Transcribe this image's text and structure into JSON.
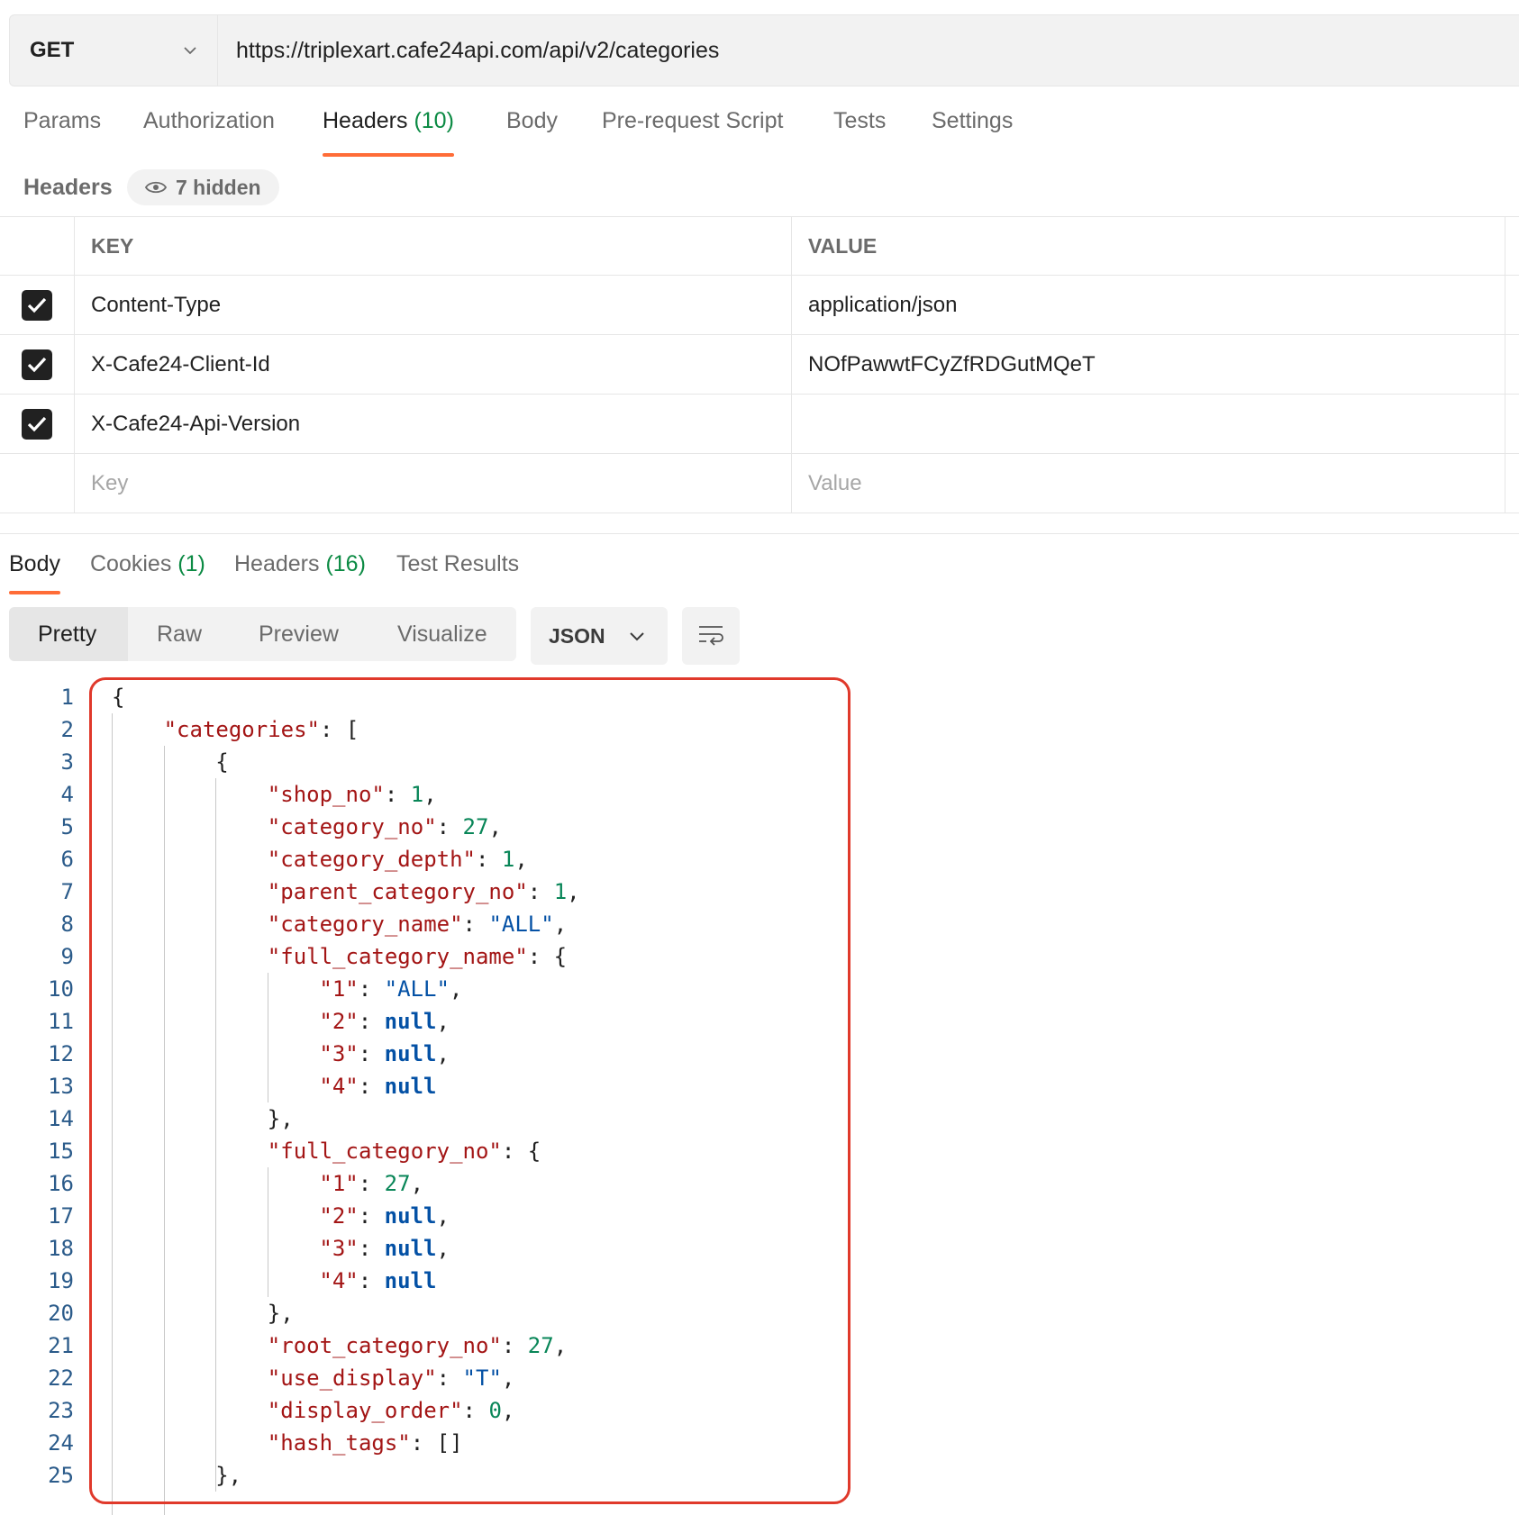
{
  "request": {
    "method": "GET",
    "url": "https://triplexart.cafe24api.com/api/v2/categories"
  },
  "request_tabs": [
    {
      "label": "Params",
      "count": ""
    },
    {
      "label": "Authorization",
      "count": ""
    },
    {
      "label": "Headers",
      "count": "(10)"
    },
    {
      "label": "Body",
      "count": ""
    },
    {
      "label": "Pre-request Script",
      "count": ""
    },
    {
      "label": "Tests",
      "count": ""
    },
    {
      "label": "Settings",
      "count": ""
    }
  ],
  "headers_section": {
    "title": "Headers",
    "hidden_label": "7 hidden",
    "col_key": "KEY",
    "col_value": "VALUE",
    "rows": [
      {
        "key": "Content-Type",
        "value": "application/json"
      },
      {
        "key": "X-Cafe24-Client-Id",
        "value": "NOfPawwtFCyZfRDGutMQeT"
      },
      {
        "key": "X-Cafe24-Api-Version",
        "value": ""
      }
    ],
    "key_placeholder": "Key",
    "value_placeholder": "Value"
  },
  "response_tabs": [
    {
      "label": "Body",
      "count": ""
    },
    {
      "label": "Cookies",
      "count": "(1)"
    },
    {
      "label": "Headers",
      "count": "(16)"
    },
    {
      "label": "Test Results",
      "count": ""
    }
  ],
  "view_modes": [
    "Pretty",
    "Raw",
    "Preview",
    "Visualize"
  ],
  "format": "JSON",
  "colors": {
    "accent": "#ff6c37",
    "count_green": "#0b8a43",
    "highlight_border": "#e0392b"
  },
  "code_lines": [
    {
      "n": "1",
      "indent": 0,
      "parts": [
        [
          "p",
          "{"
        ]
      ]
    },
    {
      "n": "2",
      "indent": 1,
      "parts": [
        [
          "k",
          "\"categories\""
        ],
        [
          "p",
          ": ["
        ]
      ]
    },
    {
      "n": "3",
      "indent": 2,
      "parts": [
        [
          "p",
          "{"
        ]
      ]
    },
    {
      "n": "4",
      "indent": 3,
      "parts": [
        [
          "k",
          "\"shop_no\""
        ],
        [
          "p",
          ": "
        ],
        [
          "n",
          "1"
        ],
        [
          "p",
          ","
        ]
      ]
    },
    {
      "n": "5",
      "indent": 3,
      "parts": [
        [
          "k",
          "\"category_no\""
        ],
        [
          "p",
          ": "
        ],
        [
          "n",
          "27"
        ],
        [
          "p",
          ","
        ]
      ]
    },
    {
      "n": "6",
      "indent": 3,
      "parts": [
        [
          "k",
          "\"category_depth\""
        ],
        [
          "p",
          ": "
        ],
        [
          "n",
          "1"
        ],
        [
          "p",
          ","
        ]
      ]
    },
    {
      "n": "7",
      "indent": 3,
      "parts": [
        [
          "k",
          "\"parent_category_no\""
        ],
        [
          "p",
          ": "
        ],
        [
          "n",
          "1"
        ],
        [
          "p",
          ","
        ]
      ]
    },
    {
      "n": "8",
      "indent": 3,
      "parts": [
        [
          "k",
          "\"category_name\""
        ],
        [
          "p",
          ": "
        ],
        [
          "s",
          "\"ALL\""
        ],
        [
          "p",
          ","
        ]
      ]
    },
    {
      "n": "9",
      "indent": 3,
      "parts": [
        [
          "k",
          "\"full_category_name\""
        ],
        [
          "p",
          ": {"
        ]
      ]
    },
    {
      "n": "10",
      "indent": 4,
      "parts": [
        [
          "k",
          "\"1\""
        ],
        [
          "p",
          ": "
        ],
        [
          "s",
          "\"ALL\""
        ],
        [
          "p",
          ","
        ]
      ]
    },
    {
      "n": "11",
      "indent": 4,
      "parts": [
        [
          "k",
          "\"2\""
        ],
        [
          "p",
          ": "
        ],
        [
          "nl",
          "null"
        ],
        [
          "p",
          ","
        ]
      ]
    },
    {
      "n": "12",
      "indent": 4,
      "parts": [
        [
          "k",
          "\"3\""
        ],
        [
          "p",
          ": "
        ],
        [
          "nl",
          "null"
        ],
        [
          "p",
          ","
        ]
      ]
    },
    {
      "n": "13",
      "indent": 4,
      "parts": [
        [
          "k",
          "\"4\""
        ],
        [
          "p",
          ": "
        ],
        [
          "nl",
          "null"
        ]
      ]
    },
    {
      "n": "14",
      "indent": 3,
      "parts": [
        [
          "p",
          "},"
        ]
      ]
    },
    {
      "n": "15",
      "indent": 3,
      "parts": [
        [
          "k",
          "\"full_category_no\""
        ],
        [
          "p",
          ": {"
        ]
      ]
    },
    {
      "n": "16",
      "indent": 4,
      "parts": [
        [
          "k",
          "\"1\""
        ],
        [
          "p",
          ": "
        ],
        [
          "n",
          "27"
        ],
        [
          "p",
          ","
        ]
      ]
    },
    {
      "n": "17",
      "indent": 4,
      "parts": [
        [
          "k",
          "\"2\""
        ],
        [
          "p",
          ": "
        ],
        [
          "nl",
          "null"
        ],
        [
          "p",
          ","
        ]
      ]
    },
    {
      "n": "18",
      "indent": 4,
      "parts": [
        [
          "k",
          "\"3\""
        ],
        [
          "p",
          ": "
        ],
        [
          "nl",
          "null"
        ],
        [
          "p",
          ","
        ]
      ]
    },
    {
      "n": "19",
      "indent": 4,
      "parts": [
        [
          "k",
          "\"4\""
        ],
        [
          "p",
          ": "
        ],
        [
          "nl",
          "null"
        ]
      ]
    },
    {
      "n": "20",
      "indent": 3,
      "parts": [
        [
          "p",
          "},"
        ]
      ]
    },
    {
      "n": "21",
      "indent": 3,
      "parts": [
        [
          "k",
          "\"root_category_no\""
        ],
        [
          "p",
          ": "
        ],
        [
          "n",
          "27"
        ],
        [
          "p",
          ","
        ]
      ]
    },
    {
      "n": "22",
      "indent": 3,
      "parts": [
        [
          "k",
          "\"use_display\""
        ],
        [
          "p",
          ": "
        ],
        [
          "s",
          "\"T\""
        ],
        [
          "p",
          ","
        ]
      ]
    },
    {
      "n": "23",
      "indent": 3,
      "parts": [
        [
          "k",
          "\"display_order\""
        ],
        [
          "p",
          ": "
        ],
        [
          "n",
          "0"
        ],
        [
          "p",
          ","
        ]
      ]
    },
    {
      "n": "24",
      "indent": 3,
      "parts": [
        [
          "k",
          "\"hash_tags\""
        ],
        [
          "p",
          ": []"
        ]
      ]
    },
    {
      "n": "25",
      "indent": 2,
      "parts": [
        [
          "p",
          "},"
        ]
      ]
    }
  ]
}
